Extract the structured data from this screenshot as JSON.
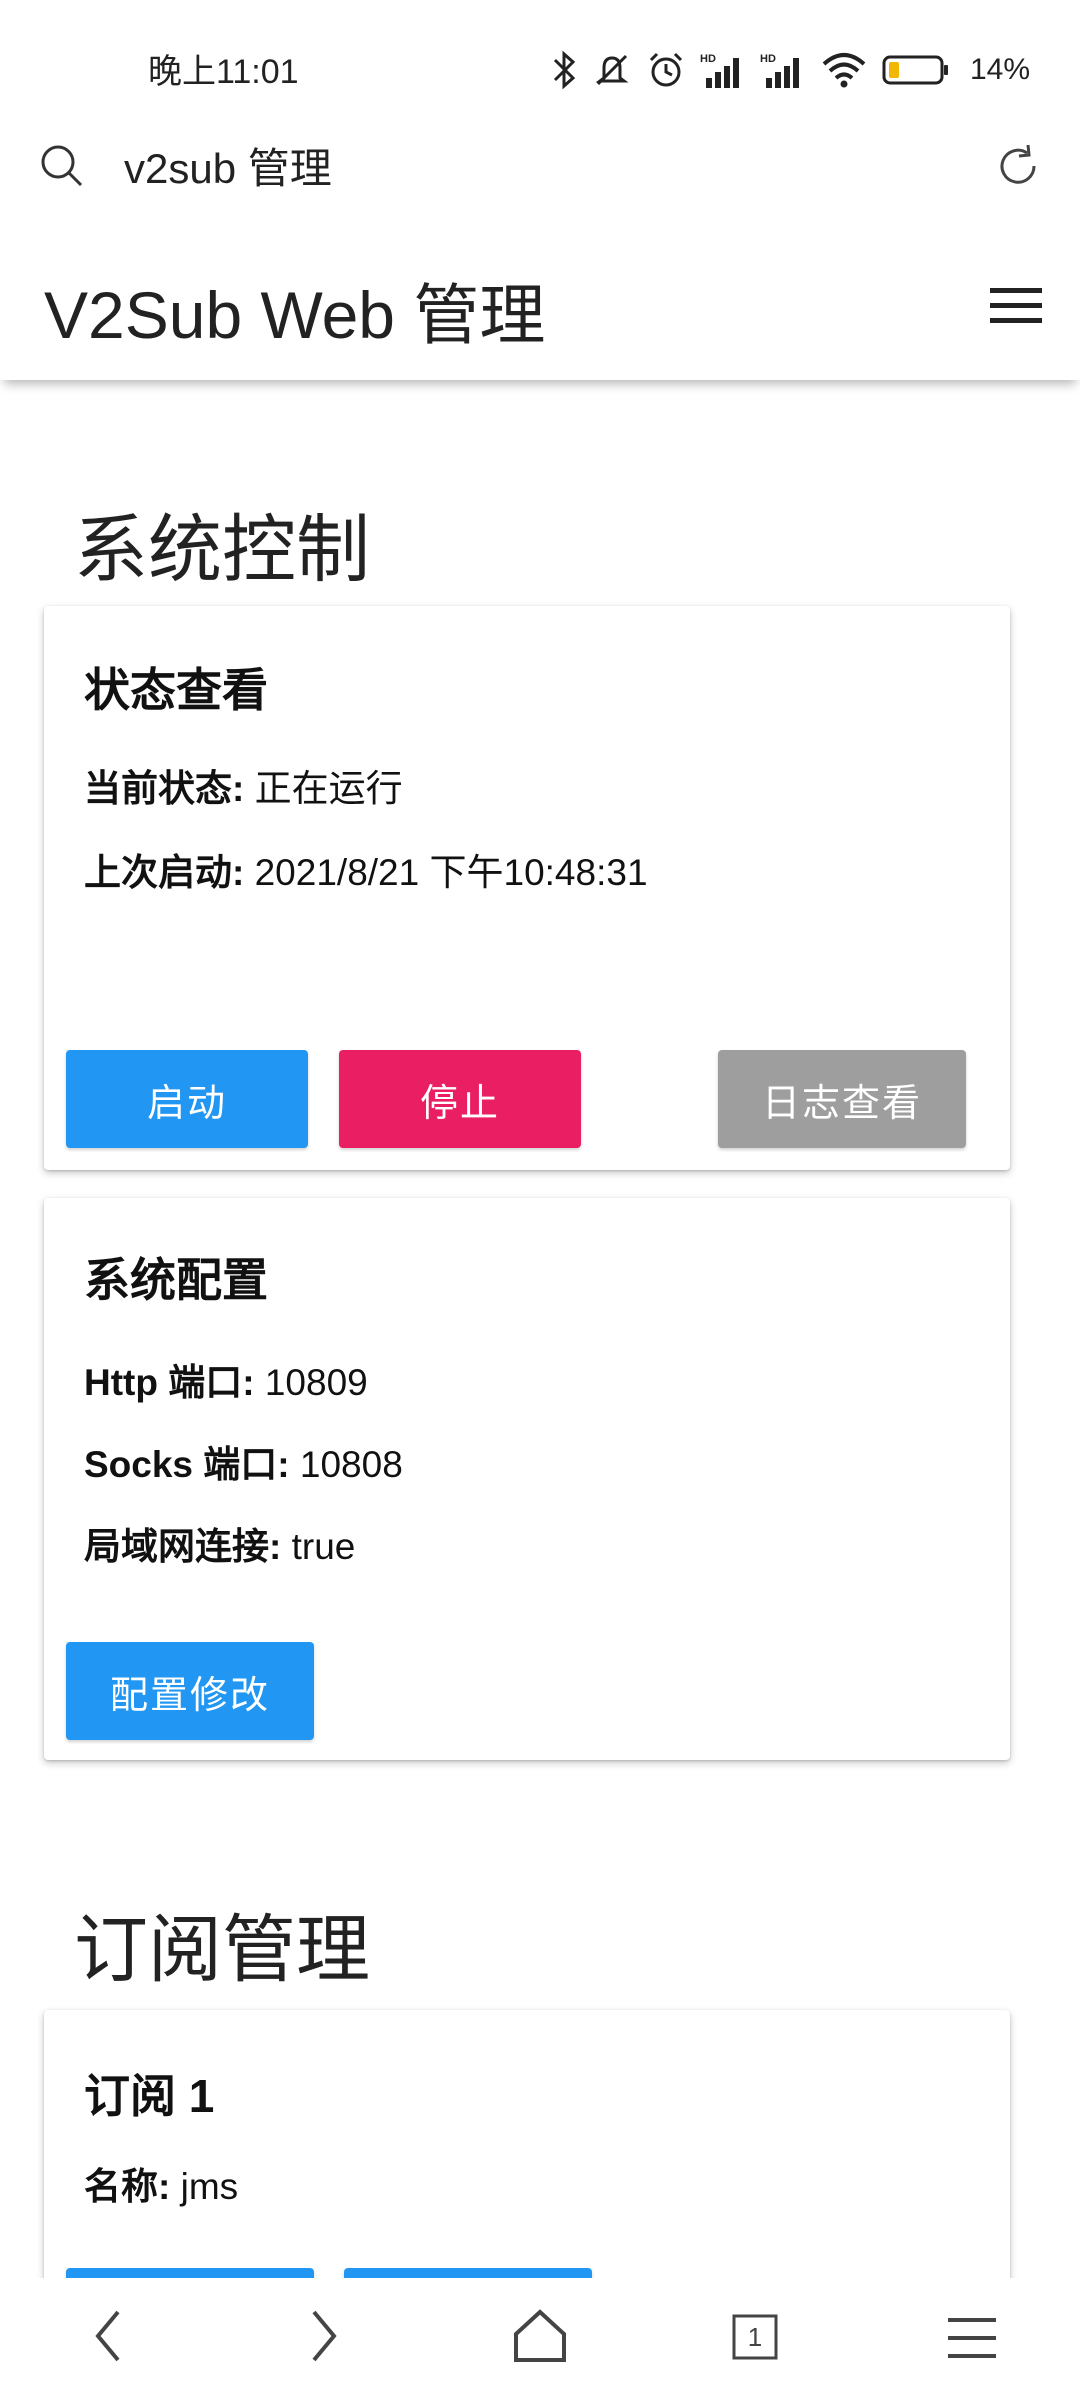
{
  "status_bar": {
    "time": "晚上11:01",
    "battery": "14%",
    "signal_label": "HD"
  },
  "browser": {
    "url": "v2sub 管理"
  },
  "app": {
    "title": "V2Sub Web 管理"
  },
  "system_control": {
    "section_title": "系统控制",
    "status_card": {
      "title": "状态查看",
      "current_state_label": "当前状态:",
      "current_state_value": "正在运行",
      "last_start_label": "上次启动:",
      "last_start_value": "2021/8/21 下午10:48:31",
      "start_button": "启动",
      "stop_button": "停止",
      "log_button": "日志查看"
    },
    "config_card": {
      "title": "系统配置",
      "http_port_label": "Http 端口:",
      "http_port_value": "10809",
      "socks_port_label": "Socks 端口:",
      "socks_port_value": "10808",
      "lan_label": "局域网连接:",
      "lan_value": "true",
      "edit_button": "配置修改"
    }
  },
  "subscription": {
    "section_title": "订阅管理",
    "card": {
      "title": "订阅 1",
      "name_label": "名称:",
      "name_value": "jms"
    }
  },
  "bottom_nav": {
    "tab_count": "1"
  },
  "colors": {
    "primary": "#2196f3",
    "danger": "#e91e63",
    "neutral": "#9e9e9e"
  },
  "icons": [
    "search-icon",
    "reload-icon",
    "menu-icon",
    "bluetooth-icon",
    "mute-icon",
    "alarm-icon",
    "signal-icon",
    "wifi-icon",
    "battery-icon",
    "back-icon",
    "forward-icon",
    "home-icon",
    "tabs-icon",
    "more-menu-icon"
  ]
}
